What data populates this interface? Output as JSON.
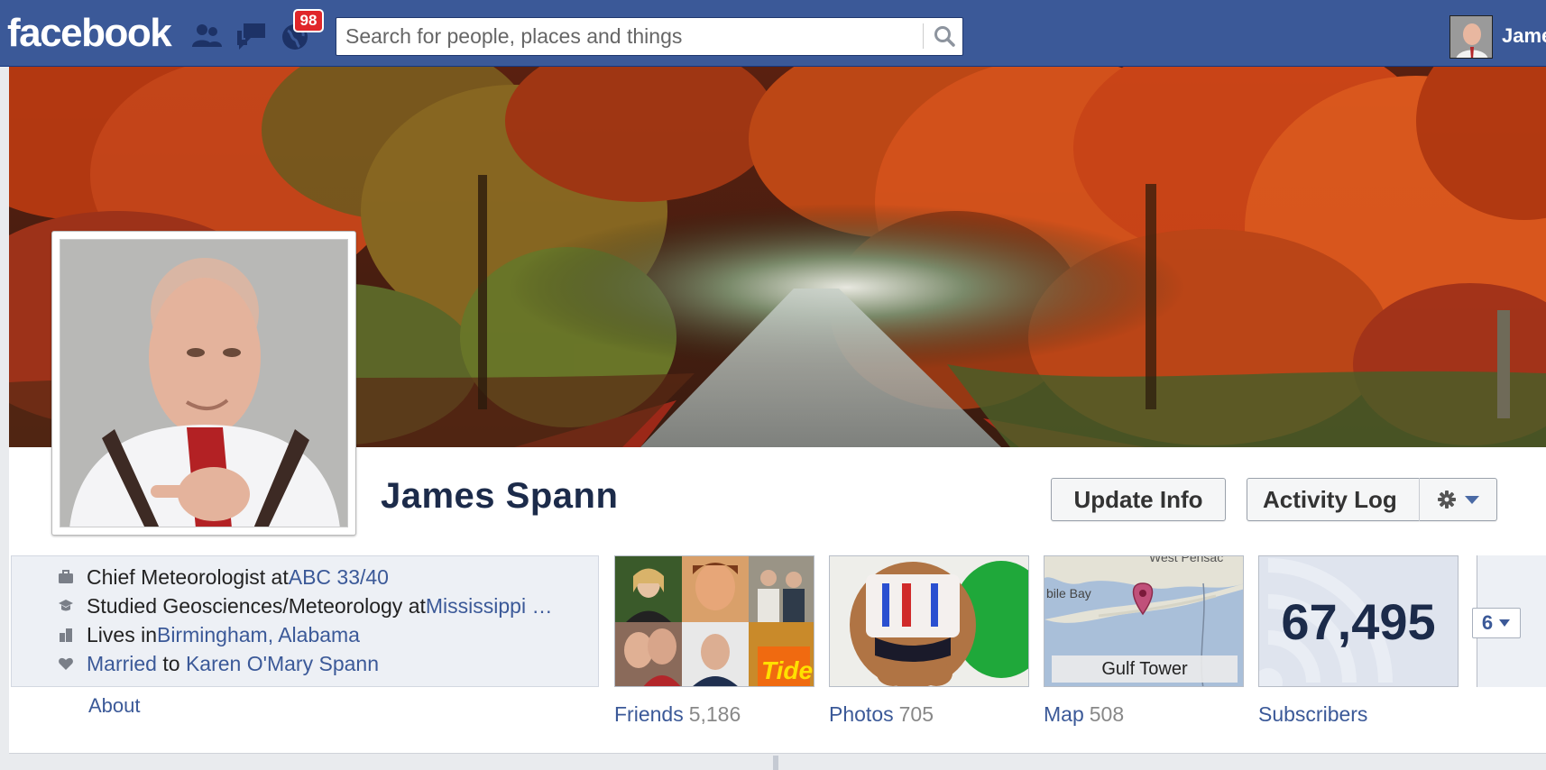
{
  "topbar": {
    "logo": "facebook",
    "notification_count": "98",
    "search_placeholder": "Search for people, places and things",
    "user_name": "James"
  },
  "profile": {
    "name": "James Spann",
    "update_info_label": "Update Info",
    "activity_log_label": "Activity Log"
  },
  "intro": {
    "work_prefix": "Chief Meteorologist at ",
    "work_link": "ABC 33/40",
    "education_prefix": "Studied Geosciences/Meteorology at ",
    "education_link": "Mississippi …",
    "lives_prefix": "Lives in ",
    "lives_link": "Birmingham, Alabama",
    "relationship_link": "Married",
    "relationship_mid": " to ",
    "relationship_partner": "Karen O'Mary Spann",
    "about_label": "About"
  },
  "tiles": {
    "friends_label": "Friends",
    "friends_count": "5,186",
    "photos_label": "Photos",
    "photos_count": "705",
    "map_label": "Map",
    "map_count": "508",
    "map_place": "Gulf Tower",
    "map_city_partial": "West Pensac",
    "map_bay_partial": "bile Bay",
    "subscribers_label": "Subscribers",
    "subscribers_count": "67,495",
    "more_count": "6"
  },
  "colors": {
    "brand_blue": "#3b5998",
    "badge_red": "#e0262a"
  }
}
